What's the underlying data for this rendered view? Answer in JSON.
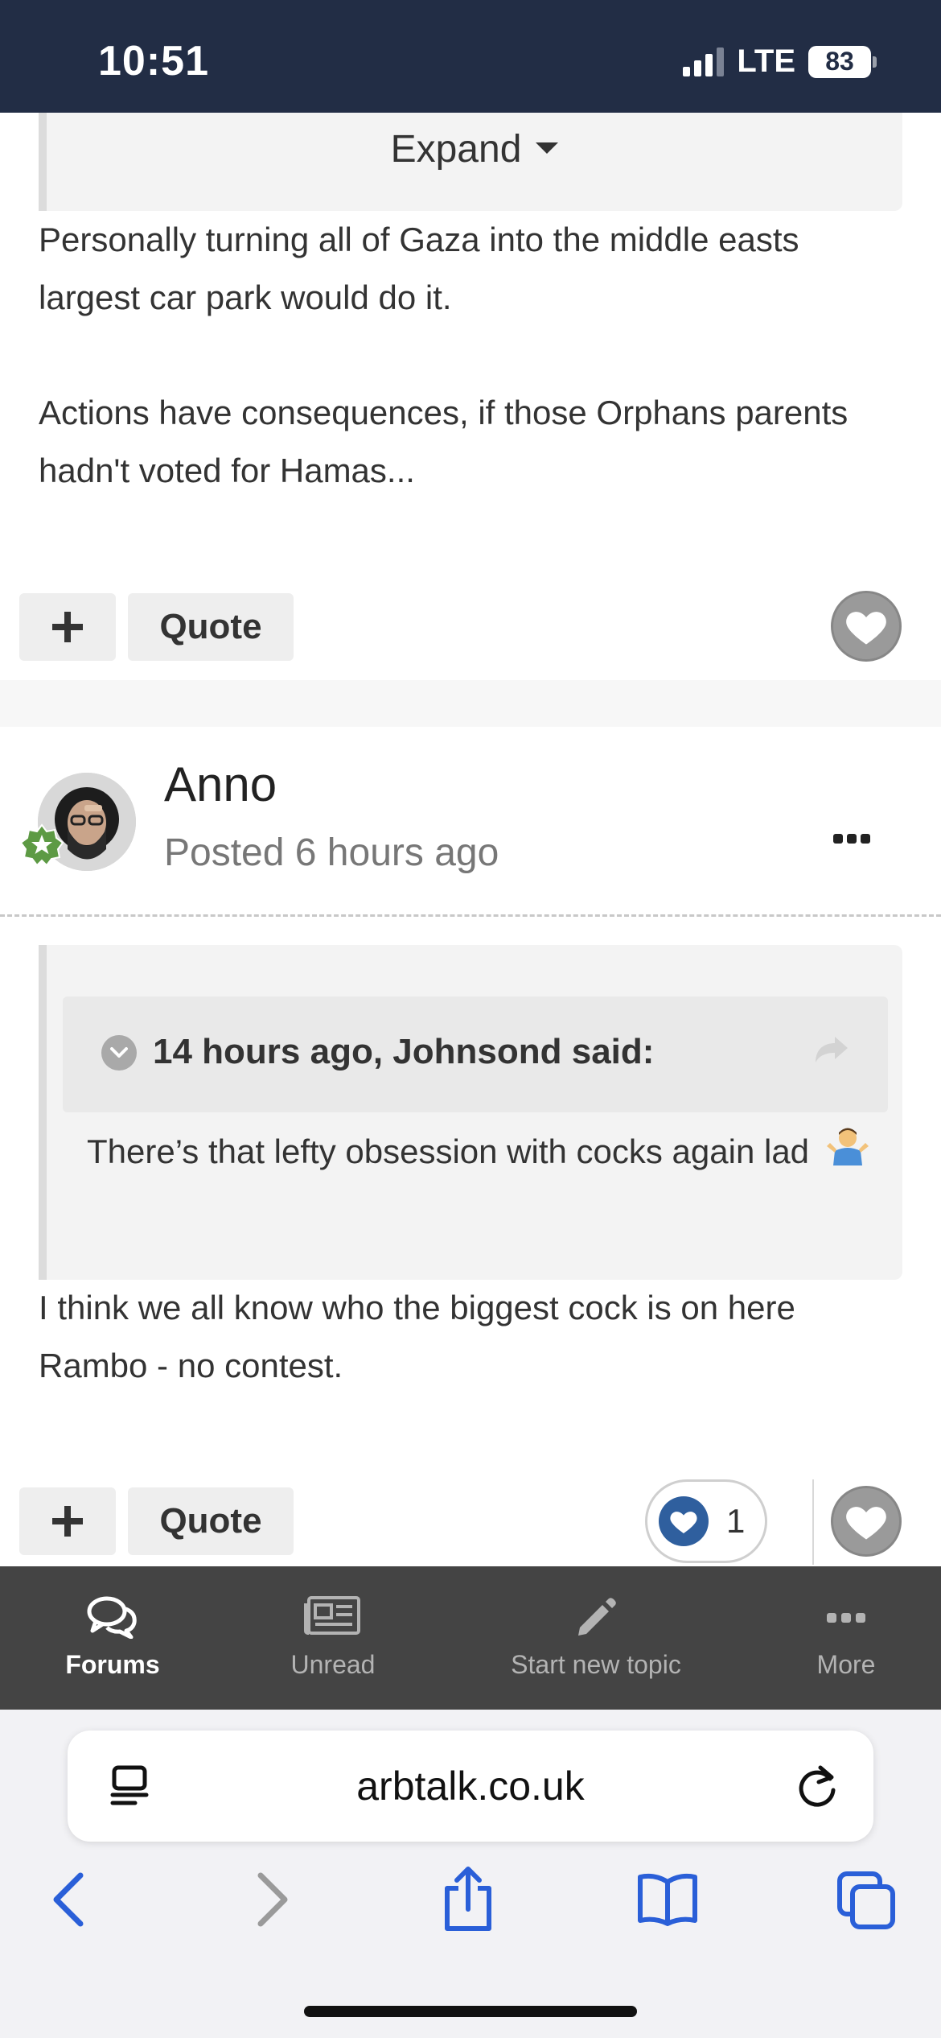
{
  "status_bar": {
    "time": "10:51",
    "network": "LTE",
    "battery": "83"
  },
  "post1": {
    "expand_label": "Expand",
    "paragraphs": [
      "Personally turning all of Gaza into the middle easts largest car park would do it.",
      "Actions have consequences, if those Orphans parents hadn't voted for Hamas..."
    ],
    "quote_label": "Quote",
    "add_label": "+"
  },
  "post2": {
    "author": "Anno",
    "posted": "Posted 6 hours ago",
    "quote": {
      "citation": "14 hours ago, Johnsond said:",
      "body": "There’s that lefty obsession with cocks again lad",
      "emoji": "shrugging-person-emoji"
    },
    "text": "I think we all know who the biggest cock is on here Rambo - no contest.",
    "quote_label": "Quote",
    "add_label": "+",
    "reaction_count": "1"
  },
  "forum_nav": {
    "items": [
      {
        "label": "Forums",
        "icon": "forums-icon",
        "active": true
      },
      {
        "label": "Unread",
        "icon": "unread-icon",
        "active": false
      },
      {
        "label": "Start new topic",
        "icon": "pencil-icon",
        "active": false
      },
      {
        "label": "More",
        "icon": "more-icon",
        "active": false
      }
    ]
  },
  "browser": {
    "url": "arbtalk.co.uk",
    "toolbar_icons": [
      "back-icon",
      "forward-icon",
      "share-icon",
      "bookmarks-icon",
      "tabs-icon"
    ]
  },
  "colors": {
    "status_bar_bg": "#222d45",
    "forum_nav_bg": "#444444",
    "reaction_blue": "#2f5f9e",
    "safari_blue": "#2a5fd8"
  }
}
